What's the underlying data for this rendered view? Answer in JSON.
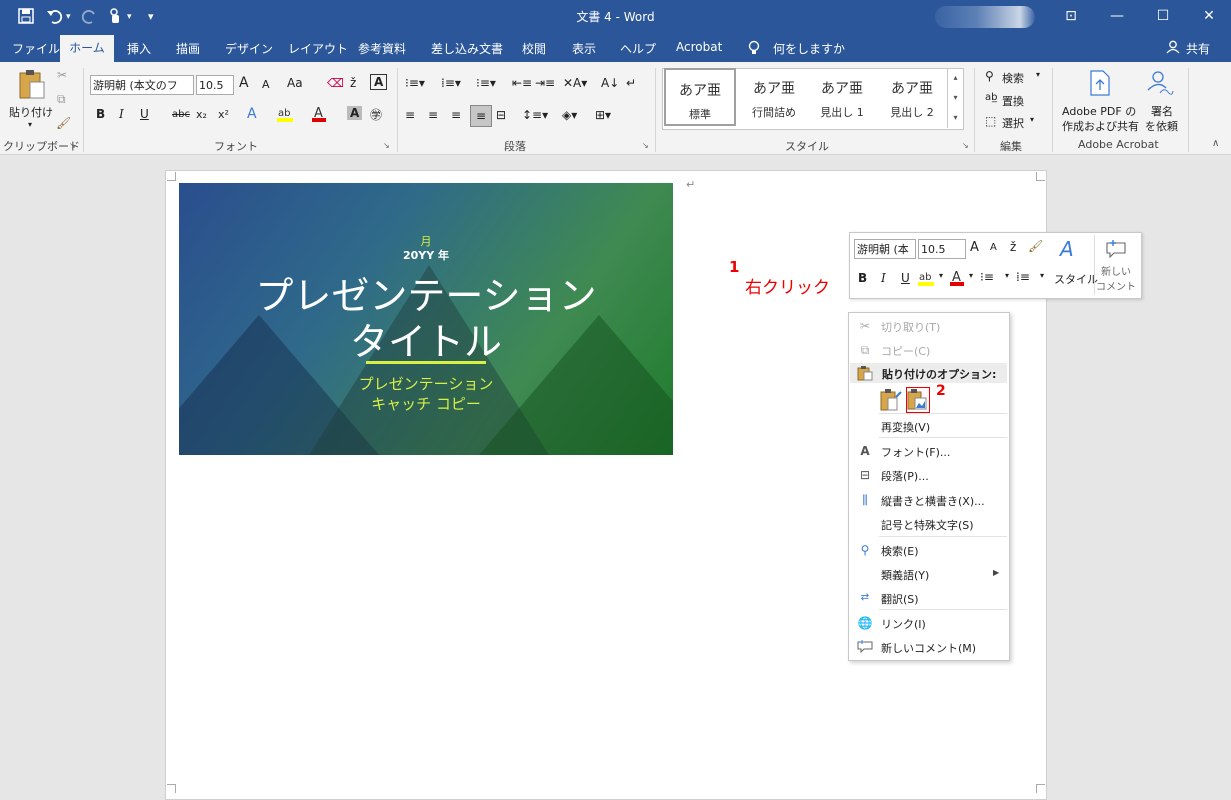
{
  "window": {
    "title": "文書 4  -  Word",
    "qat": {
      "save_icon": "save-icon",
      "undo_icon": "undo-icon",
      "redo_icon": "redo-icon",
      "touch_icon": "touch-mode-icon",
      "customize": "▾"
    },
    "controls": {
      "ribbon_display": "⊡",
      "minimize": "—",
      "maximize": "☐",
      "close": "✕"
    }
  },
  "tabs": [
    "ファイル",
    "ホーム",
    "挿入",
    "描画",
    "デザイン",
    "レイアウト",
    "参考資料",
    "差し込み文書",
    "校閲",
    "表示",
    "ヘルプ",
    "Acrobat"
  ],
  "tell_me": "何をしますか",
  "share": "共有",
  "ribbon": {
    "clipboard": {
      "paste": "貼り付け",
      "label": "クリップボード"
    },
    "font": {
      "name": "游明朝 (本文のフ",
      "size": "10.5",
      "label": "フォント",
      "grow": "A",
      "shrink": "A",
      "case": "Aa",
      "bold": "B",
      "italic": "I",
      "underline": "U",
      "strike": "abc",
      "sub": "x₂",
      "sup": "x²"
    },
    "paragraph": {
      "label": "段落"
    },
    "styles": {
      "label": "スタイル",
      "items": [
        {
          "sample": "あア亜",
          "name": "標準"
        },
        {
          "sample": "あア亜",
          "name": "行間詰め"
        },
        {
          "sample": "あア亜",
          "name": "見出し 1"
        },
        {
          "sample": "あア亜",
          "name": "見出し 2"
        }
      ]
    },
    "editing": {
      "label": "編集",
      "find": "検索",
      "replace": "置換",
      "select": "選択"
    },
    "acrobat": {
      "label": "Adobe Acrobat",
      "create_line1": "Adobe PDF の",
      "create_line2": "作成および共有",
      "sign_line1": "署名",
      "sign_line2": "を依頼"
    }
  },
  "slide": {
    "month": "月",
    "year": "20YY 年",
    "title_line1": "プレゼンテーション",
    "title_line2": "タイトル",
    "sub_line1": "プレゼンテーション",
    "sub_line2": "キャッチ コピー"
  },
  "annotations": {
    "step1_num": "1",
    "step1_text": "右クリック",
    "step2_num": "2"
  },
  "mini_toolbar": {
    "font": "游明朝 (本",
    "size": "10.5",
    "style": "スタイル",
    "comment_line1": "新しい",
    "comment_line2": "コメント"
  },
  "context_menu": {
    "cut": "切り取り(T)",
    "copy": "コピー(C)",
    "paste_header": "貼り付けのオプション:",
    "reconvert": "再変換(V)",
    "font": "フォント(F)...",
    "paragraph": "段落(P)...",
    "tate": "縦書きと横書き(X)...",
    "symbol": "記号と特殊文字(S)",
    "search": "検索(E)",
    "thesaurus": "類義語(Y)",
    "translate": "翻訳(S)",
    "link": "リンク(I)",
    "new_comment": "新しいコメント(M)"
  },
  "colors": {
    "word_blue": "#2b579a",
    "annotation_red": "#e00000",
    "slide_text_yellow": "#d8f044"
  }
}
